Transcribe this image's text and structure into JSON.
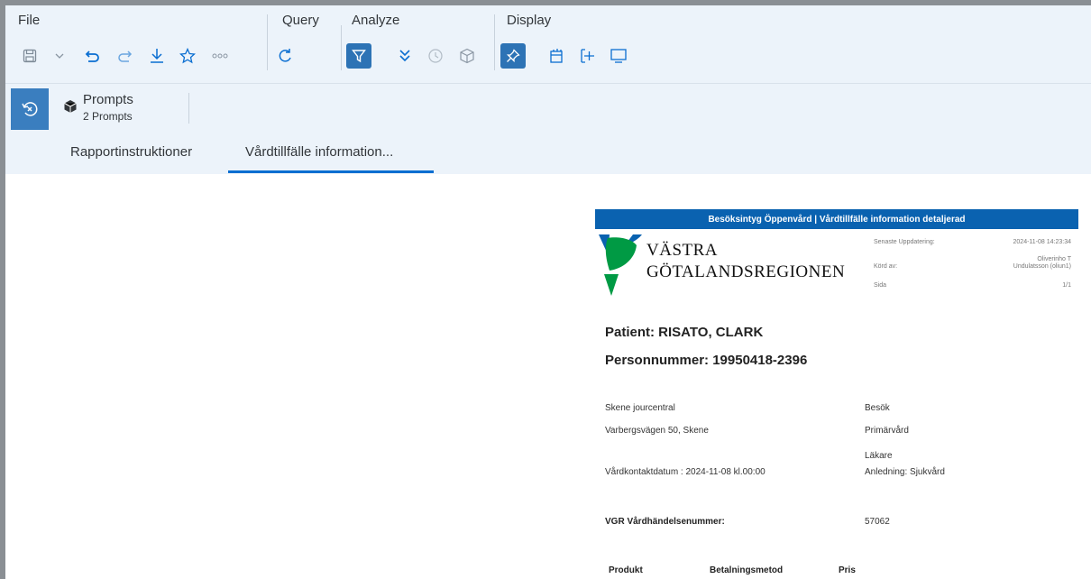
{
  "toolbar": {
    "sections": {
      "file": "File",
      "query": "Query",
      "analyze": "Analyze",
      "display": "Display"
    },
    "icons": {
      "save": "save-icon",
      "save_dropdown": "chevron-down-icon",
      "undo": "undo-icon",
      "redo": "redo-icon",
      "download": "download-icon",
      "favorite": "star-icon",
      "more": "more-icon",
      "refresh": "refresh-icon",
      "filter": "filter-icon",
      "drill": "double-chevron-down-icon",
      "history": "history-icon",
      "dimensions": "cube-icon",
      "pin": "pin-icon",
      "new_window": "new-window-icon",
      "expand": "expand-icon",
      "screen": "monitor-icon"
    }
  },
  "prompts": {
    "title": "Prompts",
    "count": "2 Prompts"
  },
  "tabs": [
    {
      "label": "Rapportinstruktioner",
      "active": false
    },
    {
      "label": "Vårdtillfälle information...",
      "active": true
    }
  ],
  "report": {
    "header_title": "Besöksintyg Öppenvård | Vårdtillfälle information detaljerad",
    "logo_line1": "VÄSTRA",
    "logo_line2": "GÖTALANDSREGIONEN",
    "meta": [
      {
        "label": "Senaste Uppdatering:",
        "value": "2024-11-08 14:23:34"
      },
      {
        "label": "Körd av:",
        "value1": "Oliverinho T",
        "value2": "Undulatsson (oliun1)"
      },
      {
        "label": "Sida",
        "value": "1/1"
      }
    ],
    "patient": "Patient: RISATO, CLARK",
    "personnummer": "Personnummer: 19950418-2396",
    "facility": "Skene jourcentral",
    "address": "Varbergsvägen 50, Skene",
    "visit_date": "Vårdkontaktdatum : 2024-11-08 kl.00:00",
    "visit_type": "Besök",
    "care_type": "Primärvård",
    "profession": "Läkare",
    "reason": "Anledning: Sjukvård",
    "event_label": "VGR Vårdhändelsenummer:",
    "event_number": "57062",
    "columns": [
      "Produkt",
      "Betalningsmetod",
      "Pris"
    ]
  },
  "colors": {
    "accent": "#0a6ed1",
    "selected": "#2d73b5",
    "report_header": "#0a62b0",
    "logo_green": "#009a44",
    "logo_blue": "#0a62b0"
  }
}
